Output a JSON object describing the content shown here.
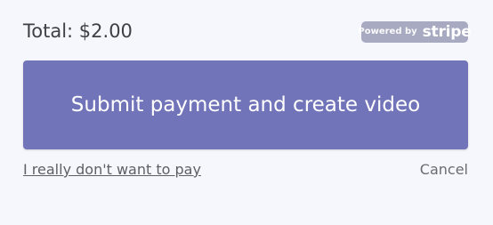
{
  "summary": {
    "total_label": "Total: $2.00"
  },
  "badge": {
    "prefix": "Powered by",
    "brand": "stripe"
  },
  "actions": {
    "submit_label": "Submit payment and create video",
    "decline_label": "I really don't want to pay",
    "cancel_label": "Cancel"
  },
  "colors": {
    "background": "#f6f7fc",
    "button": "#7174b8",
    "badge": "#a7aac0",
    "text": "#3f3f46"
  }
}
